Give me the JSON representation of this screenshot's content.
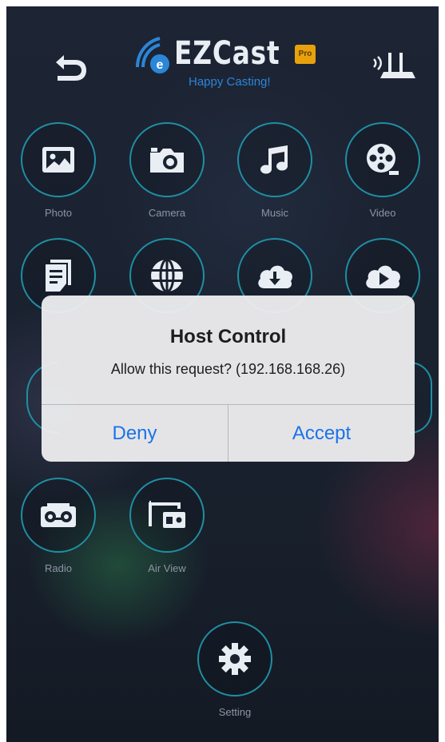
{
  "header": {
    "back_icon": "back-arrow-icon",
    "router_icon": "wifi-router-icon",
    "logo": {
      "title": "EZCast",
      "badge": "Pro",
      "tagline": "Happy Casting!"
    }
  },
  "grid": {
    "photo": {
      "label": "Photo",
      "icon": "photo-icon"
    },
    "camera": {
      "label": "Camera",
      "icon": "camera-icon"
    },
    "music": {
      "label": "Music",
      "icon": "music-icon"
    },
    "video": {
      "label": "Video",
      "icon": "film-reel-icon"
    },
    "document": {
      "icon": "document-icon"
    },
    "web": {
      "icon": "globe-icon"
    },
    "cloud_storage": {
      "icon": "cloud-download-icon"
    },
    "cloud_video": {
      "icon": "cloud-play-icon"
    },
    "radio": {
      "label": "Radio",
      "icon": "radio-icon"
    },
    "air_view": {
      "label": "Air View",
      "icon": "air-view-icon"
    },
    "setting": {
      "label": "Setting",
      "icon": "gear-icon"
    }
  },
  "dialog": {
    "title": "Host Control",
    "message": "Allow this request? (192.168.168.26)",
    "deny_label": "Deny",
    "accept_label": "Accept"
  },
  "colors": {
    "accent_ring": "#1f8fa3",
    "dialog_button": "#1a73e8",
    "tagline": "#2b86d8",
    "logo_badge": "#e8a10c"
  }
}
